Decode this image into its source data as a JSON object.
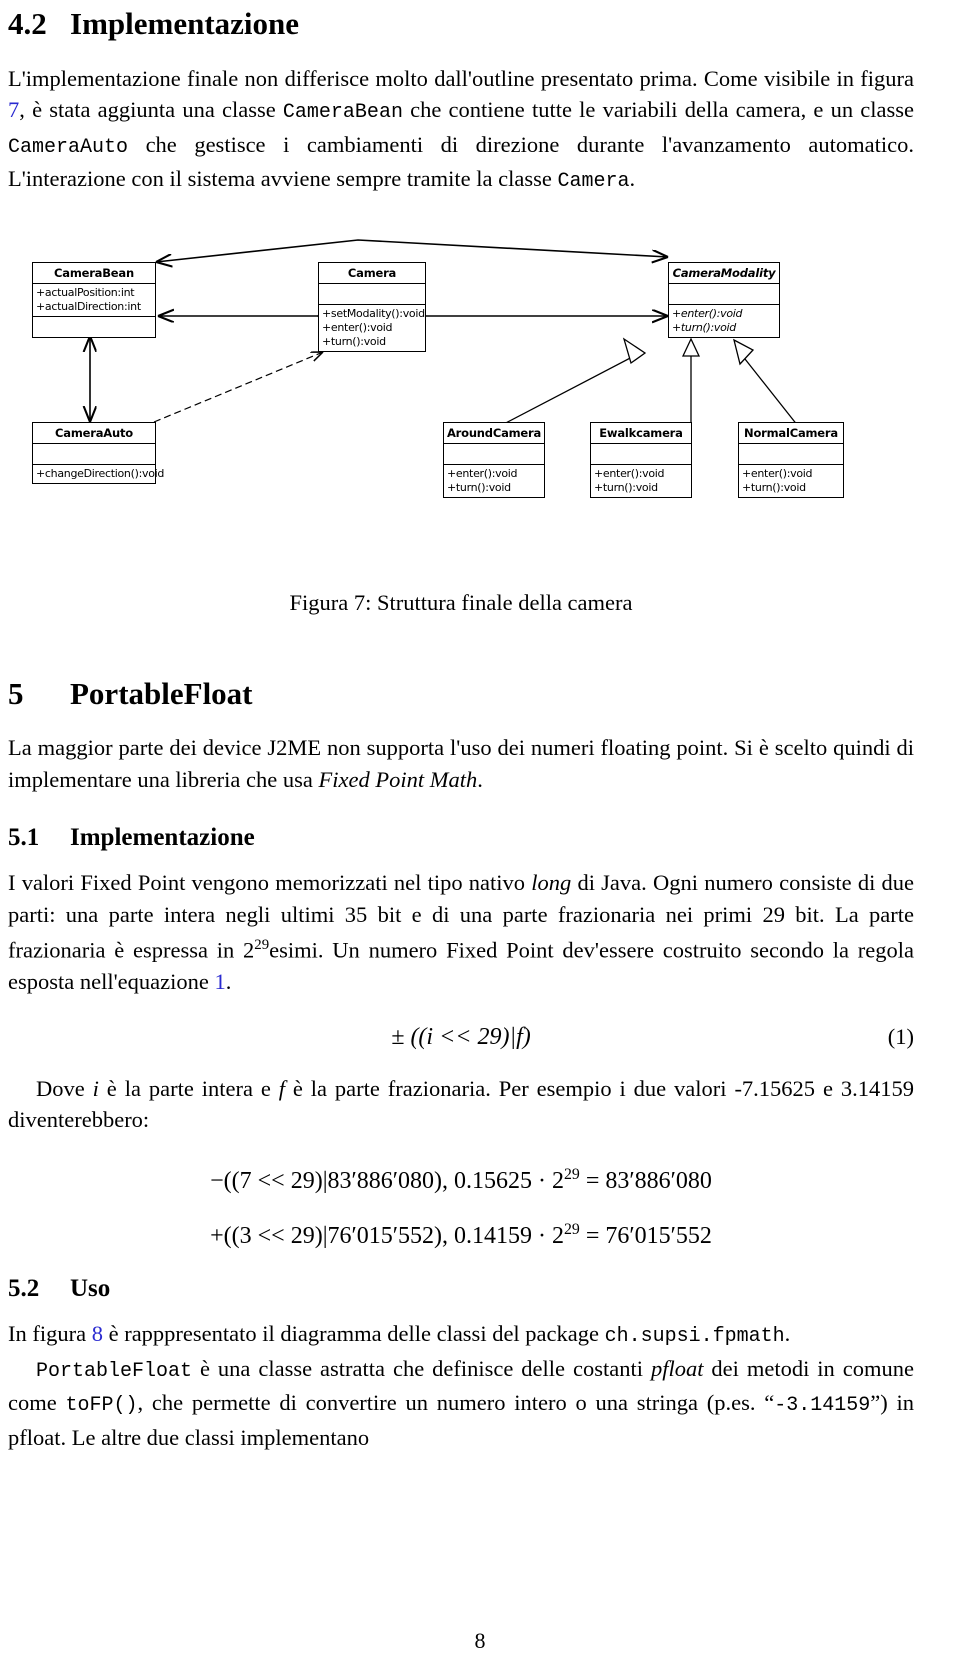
{
  "document": {
    "page_number": "8"
  },
  "section_4_2": {
    "number": "4.2",
    "title": "Implementazione",
    "paragraph_parts": {
      "p1": "L'implementazione finale non differisce molto dall'outline presentato prima. Come visibile in figura ",
      "ref_7": "7",
      "p2": ", è stata aggiunta una classe ",
      "code_camerabean": "CameraBean",
      "p3": " che contiene tutte le variabili della camera, e un classe ",
      "code_cameraauto": "CameraAuto",
      "p4": " che gestisce i cambiamenti di direzione durante l'avanzamento automatico. L'interazione con il sistema avviene sempre tramite la classe ",
      "code_camera": "Camera",
      "p5": "."
    }
  },
  "figure7": {
    "caption": "Figura 7: Struttura finale della camera",
    "classes": [
      {
        "name": "CameraBean",
        "abstract": false,
        "attributes": [
          "+actualPosition:int",
          "+actualDirection:int"
        ],
        "operations": []
      },
      {
        "name": "Camera",
        "abstract": false,
        "attributes": [],
        "operations": [
          "+setModality():void",
          "+enter():void",
          "+turn():void"
        ]
      },
      {
        "name": "CameraModality",
        "abstract": true,
        "attributes": [],
        "operations": [
          "+enter():void",
          "+turn():void"
        ]
      },
      {
        "name": "CameraAuto",
        "abstract": false,
        "attributes": [],
        "operations": [
          "+changeDirection():void"
        ]
      },
      {
        "name": "AroundCamera",
        "abstract": false,
        "attributes": [],
        "operations": [
          "+enter():void",
          "+turn():void"
        ]
      },
      {
        "name": "Ewalkcamera",
        "abstract": false,
        "attributes": [],
        "operations": [
          "+enter():void",
          "+turn():void"
        ]
      },
      {
        "name": "NormalCamera",
        "abstract": false,
        "attributes": [],
        "operations": [
          "+enter():void",
          "+turn():void"
        ]
      }
    ]
  },
  "section_5": {
    "number": "5",
    "title": "PortableFloat",
    "paragraph_parts": {
      "p1": "La maggior parte dei device J2ME non supporta l'uso dei numeri floating point. Si è scelto quindi di implementare una libreria che usa ",
      "em_fixed_point_math": "Fixed Point Math",
      "p2": "."
    }
  },
  "section_5_1": {
    "number": "5.1",
    "title": "Implementazione",
    "paragraph_parts": {
      "p1": "I valori Fixed Point vengono memorizzati nel tipo nativo ",
      "em_long": "long",
      "p2": " di Java. Ogni numero consiste di due parti: una parte intera negli ultimi 35 bit e di una parte frazionaria nei primi 29 bit. La parte frazionaria è espressa in 2",
      "sup_29": "29",
      "p3": "esimi. Un numero Fixed Point dev'essere costruito secondo la regola esposta nell'equazione ",
      "ref_1": "1",
      "p4": "."
    },
    "equation_1": {
      "text": "± ((i << 29)|f)",
      "number": "(1)"
    },
    "after_equation": {
      "p1": "Dove ",
      "em_i": "i",
      "p2": " è la parte intera e ",
      "em_f": "f",
      "p3": " è la parte frazionaria. Per esempio i due valori -7.15625 e 3.14159 diventerebbero:"
    },
    "examples": [
      {
        "lhs": "−((7 << 29)|83′886′080), 0.15625 · 2",
        "exp": "29",
        "rhs": " = 83′886′080"
      },
      {
        "lhs": "+((3 << 29)|76′015′552), 0.14159 · 2",
        "exp": "29",
        "rhs": " = 76′015′552"
      }
    ]
  },
  "section_5_2": {
    "number": "5.2",
    "title": "Uso",
    "paragraph_parts": {
      "p1": "In figura ",
      "ref_8": "8",
      "p2": " è rapppresentato il diagramma delle classi del package ",
      "code_package": "ch.supsi.fpmath",
      "p3": "."
    },
    "paragraph2_parts": {
      "p1": "",
      "code_portablefloat": "PortableFloat",
      "p2": " è una classe astratta che definisce delle costanti ",
      "em_pfloat": "pfloat",
      "p3": " dei metodi in comune come ",
      "code_tofp": "toFP()",
      "p4": ", che permette di convertire un numero intero o una stringa (p.es. “",
      "code_value": "-3.14159",
      "p5": "”) in pfloat. Le altre due classi implementano"
    }
  }
}
